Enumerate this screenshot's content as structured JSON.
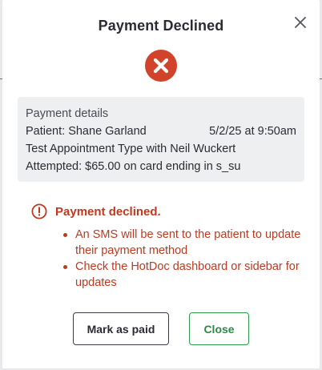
{
  "modal": {
    "title": "Payment Declined",
    "close_icon": "close-icon",
    "status_icon": "error-x-circle-icon",
    "status_color": "#d1432a"
  },
  "details": {
    "heading": "Payment details",
    "patient": "Patient: Shane Garland",
    "datetime": "5/2/25 at 9:50am",
    "appointment": "Test Appointment Type with Neil Wuckert",
    "attempted": "Attempted: $65.00 on card ending in s_su"
  },
  "error": {
    "icon": "alert-circle-icon",
    "color": "#c0391e",
    "heading": "Payment declined.",
    "items": [
      "An SMS will be sent to the patient to update their payment method",
      "Check the HotDoc dashboard or sidebar for updates"
    ]
  },
  "actions": {
    "mark_paid_label": "Mark as paid",
    "close_label": "Close",
    "close_color": "#2e9a4c"
  }
}
